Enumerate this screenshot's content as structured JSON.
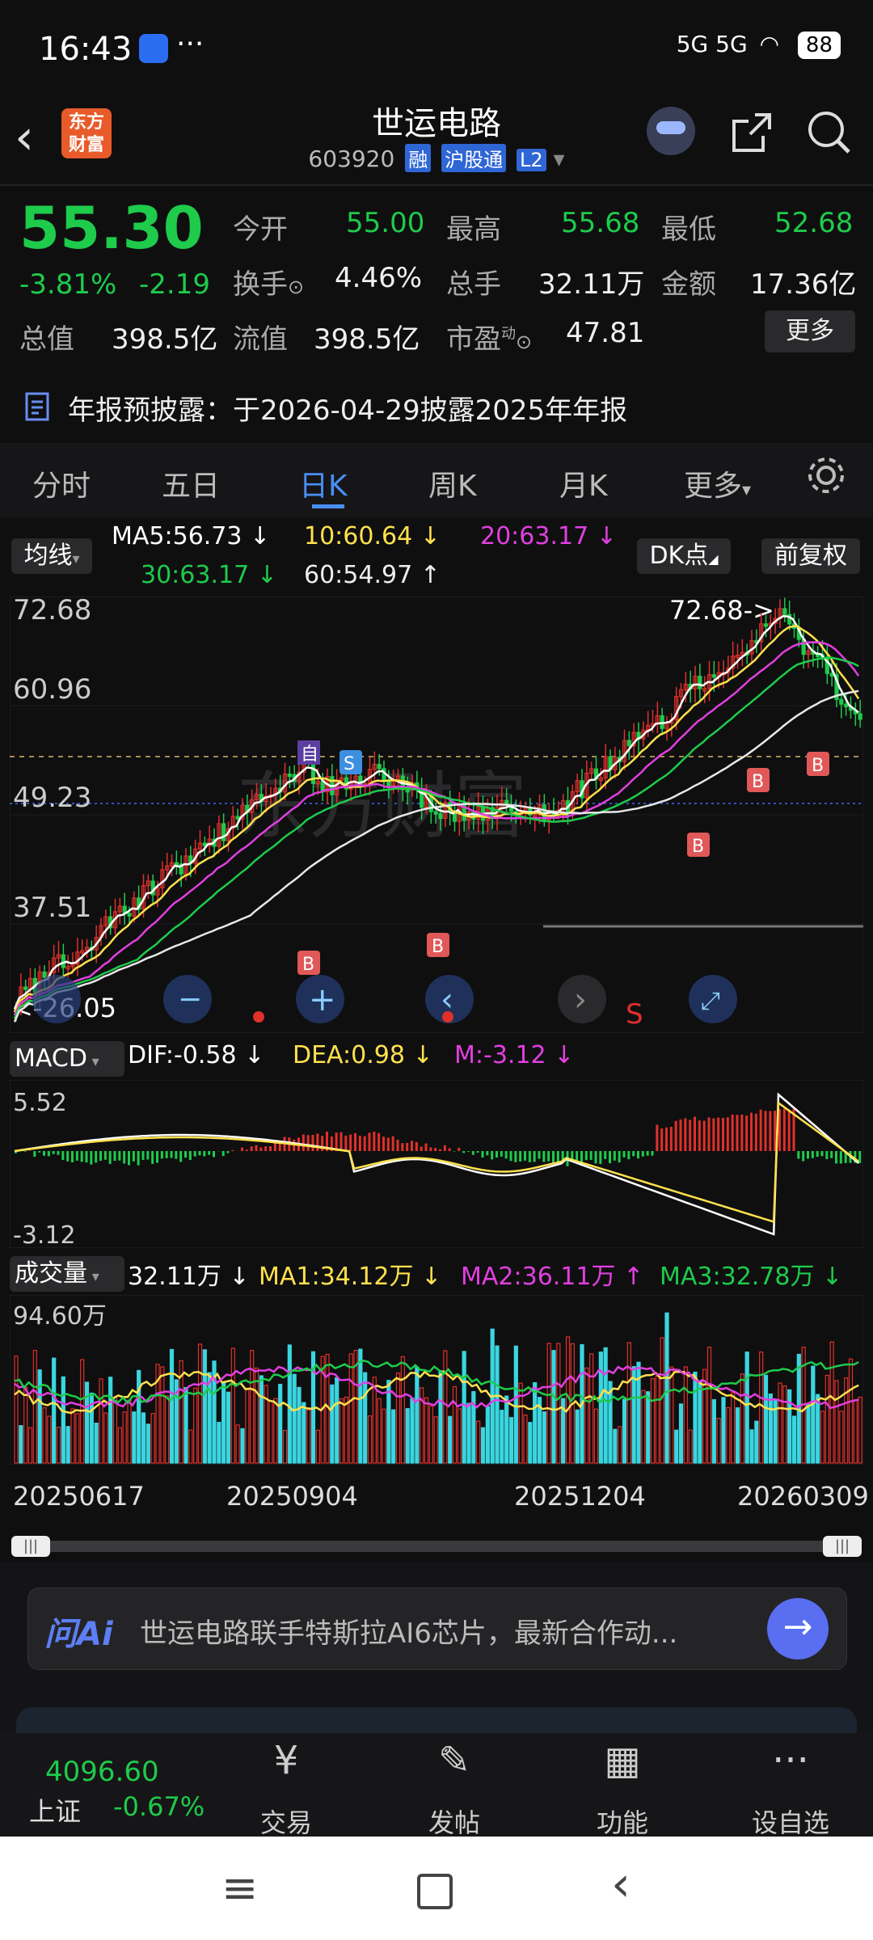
{
  "status": {
    "time": "16:43",
    "dots": "···",
    "signal": "5G  5G",
    "battery": "88"
  },
  "header": {
    "logo": "东方\n财富",
    "title": "世运电路",
    "code": "603920",
    "tags": [
      "融",
      "沪股通",
      "L2"
    ]
  },
  "quote": {
    "price": "55.30",
    "pct": "-3.81%",
    "chg": "-2.19",
    "open_label": "今开",
    "open": "55.00",
    "high_label": "最高",
    "high": "55.68",
    "low_label": "最低",
    "low": "52.68",
    "turnover_label": "换手",
    "turnover": "4.46%",
    "vol_label": "总手",
    "vol": "32.11万",
    "amt_label": "金额",
    "amt": "17.36亿",
    "mcap_label": "总值",
    "mcap": "398.5亿",
    "float_label": "流值",
    "float": "398.5亿",
    "pe_label": "市盈",
    "pe_sup": "动",
    "pe": "47.81",
    "more": "更多"
  },
  "notice": {
    "text": "年报预披露：于2026-04-29披露2025年年报"
  },
  "tabs": [
    "分时",
    "五日",
    "日K",
    "周K",
    "月K",
    "更多"
  ],
  "ma_legend": {
    "selector": "均线",
    "ma5": "MA5:56.73 ↓",
    "ma10": "10:60.64 ↓",
    "ma20": "20:63.17 ↓",
    "ma30": "30:63.17 ↓",
    "ma60": "60:54.97 ↑",
    "dk": "DK点",
    "fq": "前复权"
  },
  "kline": {
    "y_labels": [
      "72.68",
      "60.96",
      "49.23",
      "37.51"
    ],
    "high_mark": "72.68->",
    "low_mark": "<-26.05",
    "markers": {
      "self": "自",
      "sell": "S",
      "buy": "B"
    }
  },
  "macd": {
    "selector": "MACD",
    "dif": "DIF:-0.58 ↓",
    "dea": "DEA:0.98 ↓",
    "m": "M:-3.12 ↓",
    "ymax": "5.52",
    "ymin": "-3.12"
  },
  "volume": {
    "selector": "成交量",
    "vol": "32.11万 ↓",
    "ma1": "MA1:34.12万 ↓",
    "ma2": "MA2:36.11万 ↑",
    "ma3": "MA3:32.78万 ↓",
    "ymax": "94.60万"
  },
  "dates": [
    "20250617",
    "20250904",
    "20251204",
    "20260309"
  ],
  "ai": {
    "logo": "问Ai",
    "text": "世运电路联手特斯拉AI6芯片，最新合作动..."
  },
  "index": {
    "value": "4096.60",
    "name": "上证",
    "chg": "-0.67%"
  },
  "nav": [
    {
      "label": "交易",
      "icon": "¥"
    },
    {
      "label": "发帖",
      "icon": "✎"
    },
    {
      "label": "功能",
      "icon": "▦"
    },
    {
      "label": "设自选",
      "icon": "···"
    }
  ],
  "colors": {
    "up": "#e0302a",
    "down": "#1ecb4b",
    "accent": "#4a8ef2",
    "vol_down": "#3ad6e0"
  }
}
